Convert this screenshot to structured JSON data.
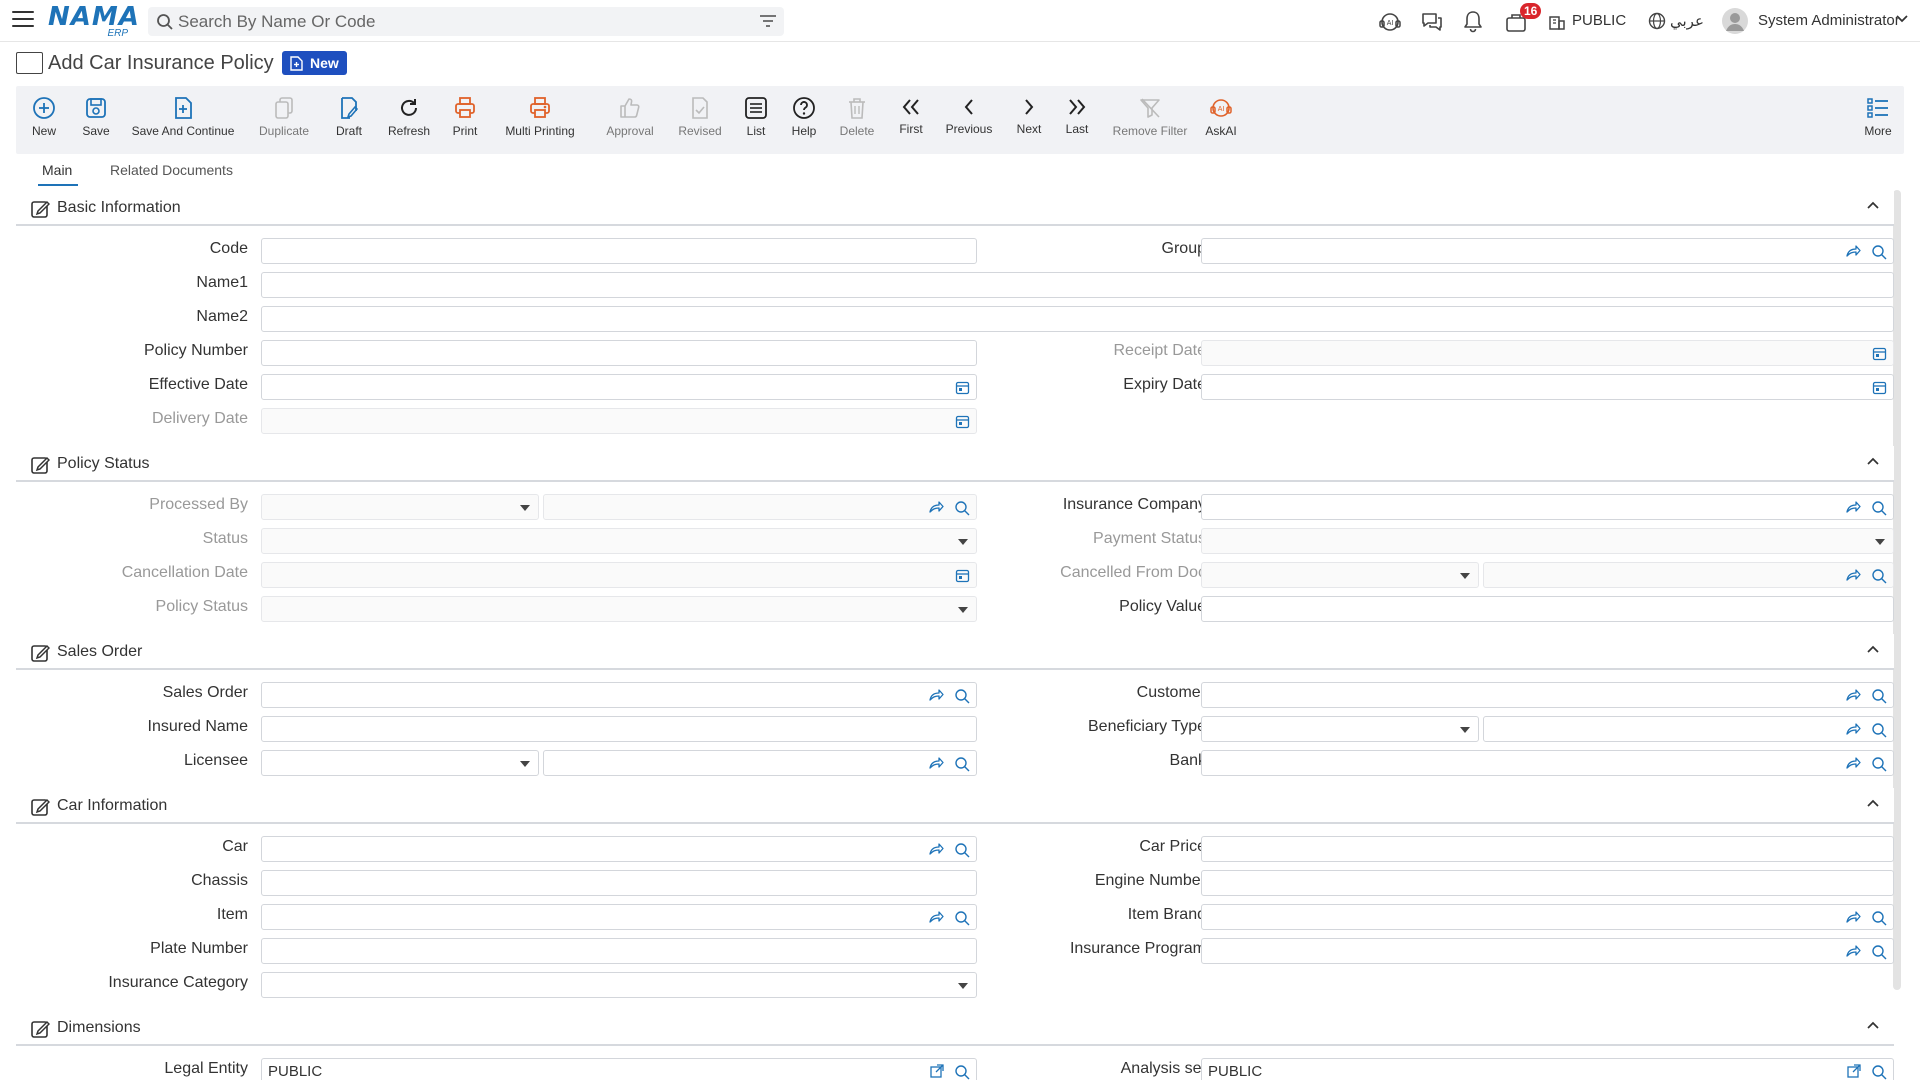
{
  "app": {
    "logo": "NAMA",
    "logo_sub": "ERP",
    "search_placeholder": "Search By Name Or Code",
    "notification_count": "16",
    "branch": "PUBLIC",
    "language": "عربي",
    "user": "System Administrator"
  },
  "page": {
    "title": "Add Car Insurance Policy",
    "badge": "New"
  },
  "toolbar": {
    "new": "New",
    "save": "Save",
    "save_continue": "Save And Continue",
    "duplicate": "Duplicate",
    "draft": "Draft",
    "refresh": "Refresh",
    "print": "Print",
    "multi_printing": "Multi Printing",
    "approval": "Approval",
    "revised": "Revised",
    "list": "List",
    "help": "Help",
    "delete": "Delete",
    "first": "First",
    "previous": "Previous",
    "next": "Next",
    "last": "Last",
    "remove_filter": "Remove Filter",
    "askai": "AskAI",
    "more": "More"
  },
  "tabs": {
    "main": "Main",
    "related": "Related Documents"
  },
  "sections": {
    "basic": "Basic Information",
    "policy_status": "Policy Status",
    "sales_order": "Sales Order",
    "car_info": "Car Information",
    "dimensions": "Dimensions"
  },
  "labels": {
    "code": "Code",
    "group": "Group",
    "name1": "Name1",
    "name2": "Name2",
    "policy_number": "Policy Number",
    "receipt_date": "Receipt Date",
    "effective_date": "Effective Date",
    "expiry_date": "Expiry Date",
    "delivery_date": "Delivery Date",
    "processed_by": "Processed By",
    "insurance_company": "Insurance Company",
    "status": "Status",
    "payment_status": "Payment Status",
    "cancellation_date": "Cancellation Date",
    "cancelled_from_doc": "Cancelled From Doc",
    "policy_status": "Policy Status",
    "policy_value": "Policy Value",
    "sales_order": "Sales Order",
    "customer": "Customer",
    "insured_name": "Insured Name",
    "beneficiary_type": "Beneficiary Type",
    "licensee": "Licensee",
    "bank": "Bank",
    "car": "Car",
    "car_price": "Car Price",
    "chassis": "Chassis",
    "engine_number": "Engine Number",
    "item": "Item",
    "item_brand": "Item Brand",
    "plate_number": "Plate Number",
    "insurance_program": "Insurance Program",
    "insurance_category": "Insurance Category",
    "legal_entity": "Legal Entity",
    "analysis_set": "Analysis set"
  },
  "values": {
    "legal_entity": "PUBLIC",
    "analysis_set": "PUBLIC"
  },
  "colors": {
    "brand_blue": "#1e73b8",
    "badge_blue": "#1e4fbf",
    "print_orange": "#e0622a",
    "notification_red": "#d9262c"
  }
}
